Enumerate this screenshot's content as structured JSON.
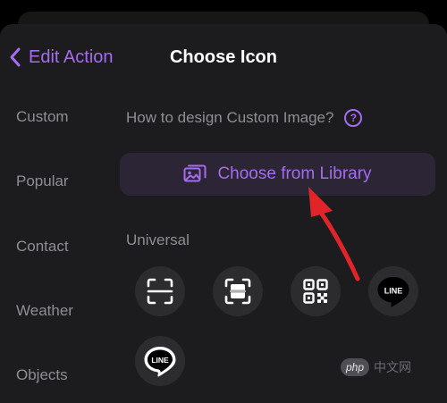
{
  "header": {
    "back_label": "Edit Action",
    "title": "Choose Icon"
  },
  "sidebar": {
    "items": [
      {
        "label": "Custom"
      },
      {
        "label": "Popular"
      },
      {
        "label": "Contact"
      },
      {
        "label": "Weather"
      },
      {
        "label": "Objects"
      }
    ]
  },
  "main": {
    "help_text": "How to design Custom Image?",
    "help_icon_glyph": "?",
    "library_button_label": "Choose from Library",
    "section_label": "Universal",
    "icons": [
      {
        "icon": "scan-frame-icon"
      },
      {
        "icon": "scan-document-icon"
      },
      {
        "icon": "qr-code-icon"
      },
      {
        "icon": "line-app-icon",
        "text": "LINE"
      },
      {
        "icon": "line-app-outline-icon",
        "text": "LINE"
      }
    ]
  },
  "watermark": {
    "logo_text": "php",
    "text": "中文网"
  },
  "colors": {
    "accent": "#a56cf0",
    "background": "#1c1c1e",
    "annotation_arrow": "#e0242a"
  }
}
